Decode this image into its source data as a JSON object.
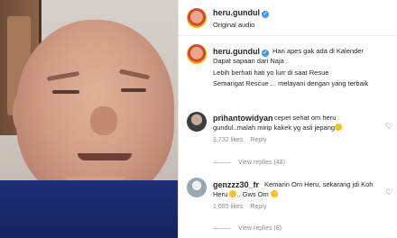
{
  "post": {
    "username": "heru.gundul",
    "subtitle": "Original audio"
  },
  "caption": {
    "username": "heru.gundul",
    "lines": [
      "Hari apes gak ada di Kalender",
      "Dapat sapaan dari Naja .",
      "Lebih berhati hati yo lurr di saat Resue",
      "Semangat Rescue ... melayani dengan yang terbaik"
    ]
  },
  "comments": [
    {
      "username": "prihantowidyan",
      "line1": "cepet sehat om heru",
      "line2": "gundul..malah mirip kakek yg asli jepang",
      "emoji_end": "😂",
      "likes": "3,732 likes",
      "reply": "Reply",
      "view_replies": "View replies (48)"
    },
    {
      "username": "genzzz30_fr",
      "line1": "Kemarin Om Heru, sekarang jdi Koh",
      "line2_prefix": "Heru",
      "line2_mid": ".. Gws Om",
      "emoji_1": "😭",
      "emoji_2": "🥺",
      "likes": "1,695 likes",
      "reply": "Reply",
      "view_replies": "View replies (8)"
    }
  ],
  "colors": {
    "verified": "#3897f0",
    "muted": "#8e8e8e",
    "text": "#262626"
  },
  "icons": {
    "verified": "verified-badge-icon",
    "heart": "heart-icon"
  }
}
